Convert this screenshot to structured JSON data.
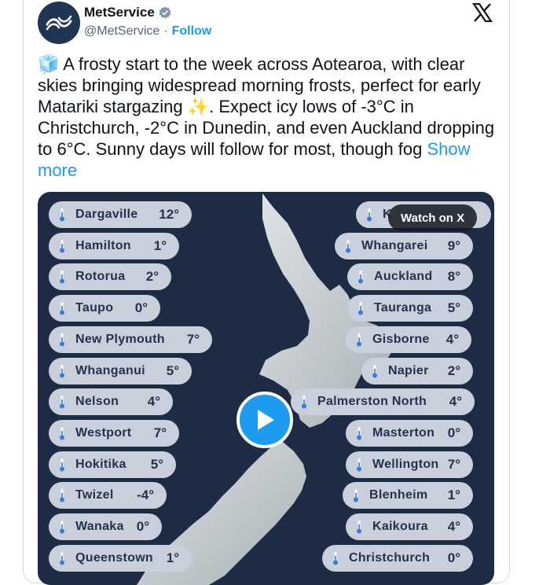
{
  "account": {
    "name": "MetService",
    "handle": "@MetService",
    "separator": "·",
    "follow_label": "Follow"
  },
  "tweet": {
    "emoji_ice": "🧊",
    "text_1": " A frosty start to the week across Aotearoa, with clear skies bringing widespread morning frosts, perfect for early Matariki stargazing ",
    "emoji_sparkles": "✨",
    "text_2": ". Expect icy lows of -3°C in Christchurch, -2°C in Dunedin, and even Auckland dropping to 6°C. Sunny days will follow for most, though fog ",
    "show_more": "Show more"
  },
  "media": {
    "watch_label": "Watch on X",
    "left_cities": [
      {
        "city": "Dargaville",
        "temp": "12°"
      },
      {
        "city": "Hamilton",
        "temp": "1°"
      },
      {
        "city": "Rotorua",
        "temp": "2°"
      },
      {
        "city": "Taupo",
        "temp": "0°"
      },
      {
        "city": "New Plymouth",
        "temp": "7°"
      },
      {
        "city": "Whanganui",
        "temp": "5°"
      },
      {
        "city": "Nelson",
        "temp": "4°"
      },
      {
        "city": "Westport",
        "temp": "7°"
      },
      {
        "city": "Hokitika",
        "temp": "5°"
      },
      {
        "city": "Twizel",
        "temp": "-4°"
      },
      {
        "city": "Wanaka",
        "temp": "0°"
      },
      {
        "city": "Queenstown",
        "temp": "1°"
      }
    ],
    "right_cities": [
      {
        "city": "K",
        "temp": ""
      },
      {
        "city": "Whangarei",
        "temp": "9°"
      },
      {
        "city": "Auckland",
        "temp": "8°"
      },
      {
        "city": "Tauranga",
        "temp": "5°"
      },
      {
        "city": "Gisborne",
        "temp": "4°"
      },
      {
        "city": "Napier",
        "temp": "2°"
      },
      {
        "city": "Palmerston North",
        "temp": "4°"
      },
      {
        "city": "Masterton",
        "temp": "0°"
      },
      {
        "city": "Wellington",
        "temp": "7°"
      },
      {
        "city": "Blenheim",
        "temp": "1°"
      },
      {
        "city": "Kaikoura",
        "temp": "4°"
      },
      {
        "city": "Christchurch",
        "temp": "0°"
      }
    ]
  },
  "colors": {
    "brand_blue": "#1d9bf0",
    "map_background": "#1e2b45",
    "pill_background": "#c9d0dc",
    "pill_text": "#24324d"
  }
}
